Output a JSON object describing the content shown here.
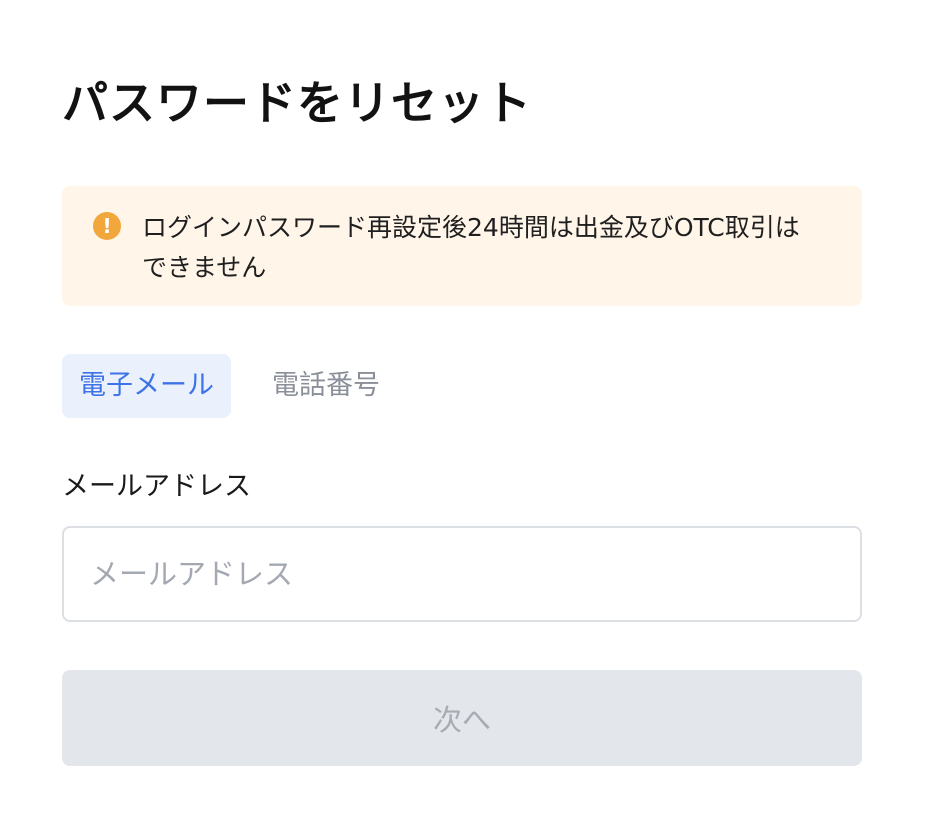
{
  "page": {
    "title": "パスワードをリセット"
  },
  "notice": {
    "icon": "exclamation-circle-icon",
    "icon_glyph": "!",
    "icon_color": "#f2a73c",
    "background": "#fff5e9",
    "text": "ログインパスワード再設定後24時間は出金及びOTC取引はできません"
  },
  "tabs": [
    {
      "label": "電子メール",
      "active": true
    },
    {
      "label": "電話番号",
      "active": false
    }
  ],
  "form": {
    "email_label": "メールアドレス",
    "email_value": "",
    "email_placeholder": "メールアドレス",
    "next_label": "次へ",
    "next_enabled": false
  },
  "colors": {
    "accent": "#3d73e6",
    "active_tab_bg": "#eaf1fd",
    "disabled_button_bg": "#e3e6ea",
    "disabled_button_text": "#a7abb3"
  }
}
